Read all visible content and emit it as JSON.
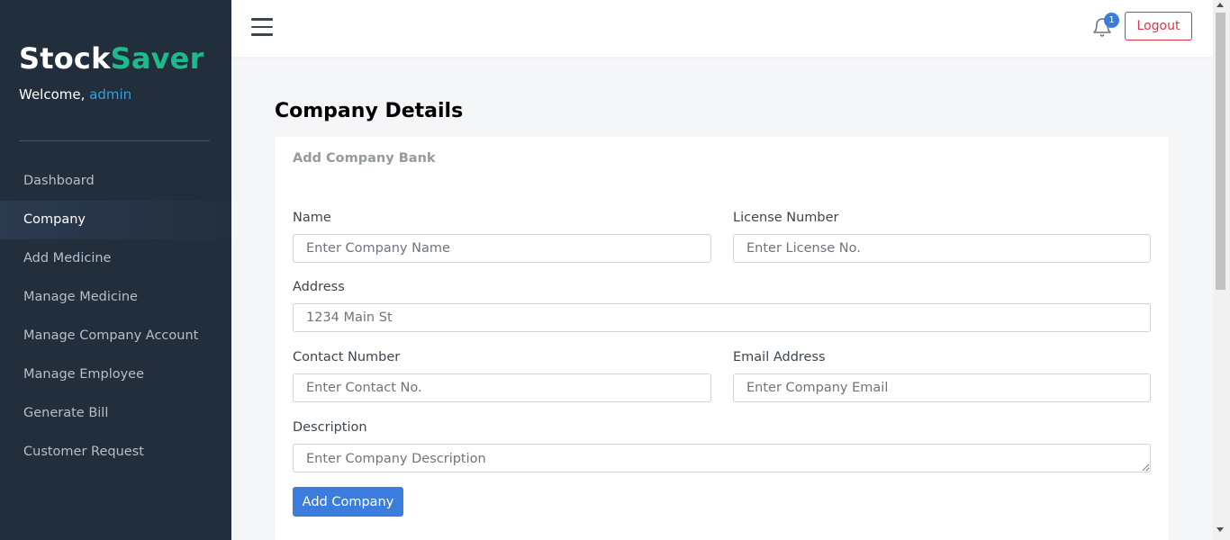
{
  "sidebar": {
    "brand_part1": "Stock",
    "brand_part2": "Saver",
    "welcome_prefix": "Welcome, ",
    "welcome_user": "admin",
    "items": [
      {
        "label": "Dashboard"
      },
      {
        "label": "Company"
      },
      {
        "label": "Add Medicine"
      },
      {
        "label": "Manage Medicine"
      },
      {
        "label": "Manage Company Account"
      },
      {
        "label": "Manage Employee"
      },
      {
        "label": "Generate Bill"
      },
      {
        "label": "Customer Request"
      }
    ],
    "active_index": 1
  },
  "topbar": {
    "notification_count": "1",
    "logout_label": "Logout"
  },
  "page": {
    "title_bold": "Company",
    "title_rest": " Details"
  },
  "form": {
    "card_title": "Add Company Bank",
    "name_label": "Name",
    "name_placeholder": "Enter Company Name",
    "license_label": "License Number",
    "license_placeholder": "Enter License No.",
    "address_label": "Address",
    "address_placeholder": "1234 Main St",
    "contact_label": "Contact Number",
    "contact_placeholder": "Enter Contact No.",
    "email_label": "Email Address",
    "email_placeholder": "Enter Company Email",
    "description_label": "Description",
    "description_placeholder": "Enter Company Description",
    "submit_label": "Add Company"
  },
  "colors": {
    "sidebar_bg": "#222e3c",
    "brand_accent": "#1cbb8c",
    "primary": "#3b7ddd",
    "danger": "#dc3545"
  },
  "icons": {
    "menu": "hamburger-menu-icon",
    "notifications": "bell-icon"
  }
}
